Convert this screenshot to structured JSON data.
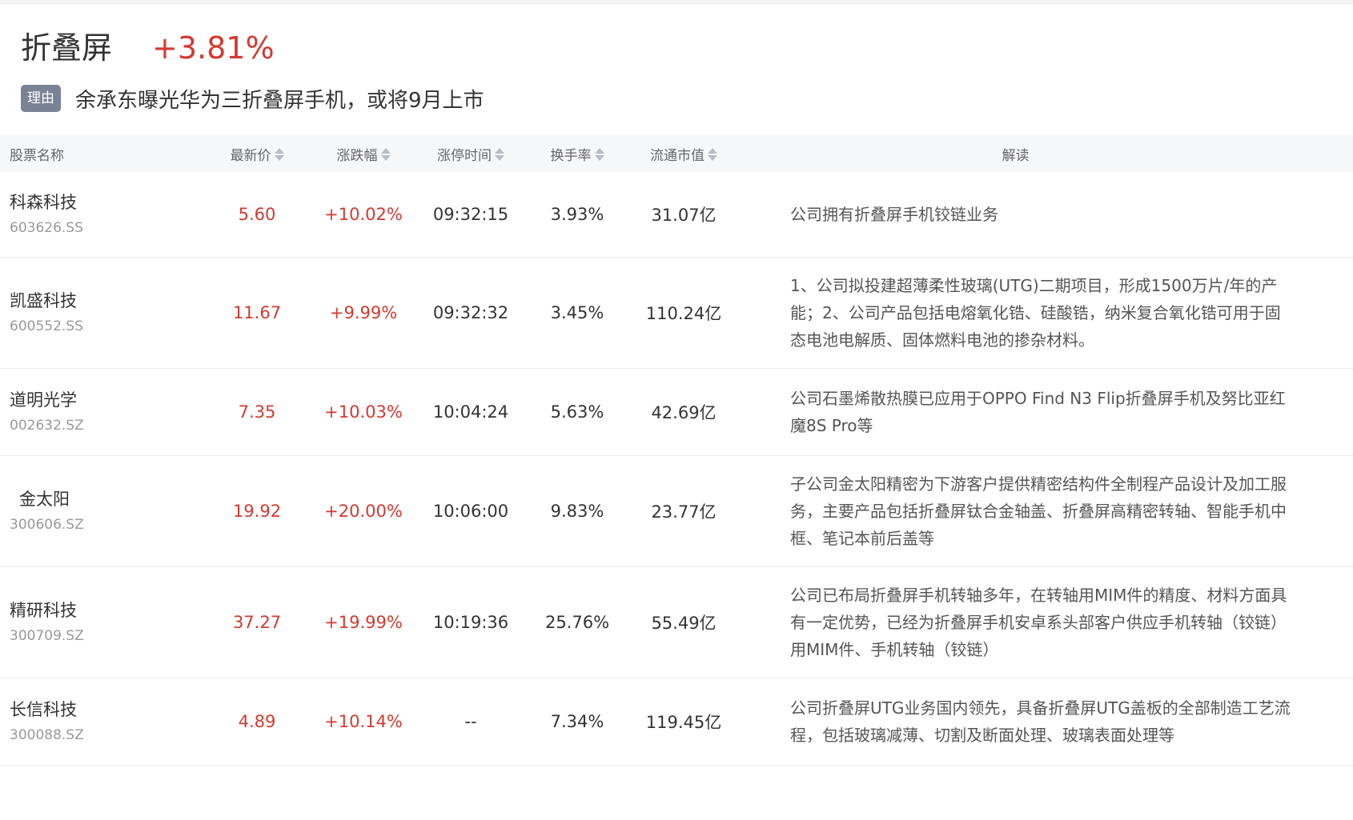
{
  "topic": {
    "title": "折叠屏",
    "change": "+3.81%",
    "reason_label": "理由",
    "reason_text": "余承东曝光华为三折叠屏手机，或将9月上市"
  },
  "table": {
    "columns": [
      "股票名称",
      "最新价",
      "涨跌幅",
      "涨停时间",
      "换手率",
      "流通市值",
      "解读"
    ],
    "sortable_columns": [
      "最新价",
      "涨跌幅",
      "涨停时间",
      "换手率",
      "流通市值"
    ],
    "rows": [
      {
        "name": "科森科技",
        "code": "603626.SS",
        "price": "5.60",
        "change": "+10.02%",
        "limit_time": "09:32:15",
        "turnover": "3.93%",
        "float_cap": "31.07亿",
        "desc": "公司拥有折叠屏手机铰链业务"
      },
      {
        "name": "凯盛科技",
        "code": "600552.SS",
        "price": "11.67",
        "change": "+9.99%",
        "limit_time": "09:32:32",
        "turnover": "3.45%",
        "float_cap": "110.24亿",
        "desc": "1、公司拟投建超薄柔性玻璃(UTG)二期项目，形成1500万片/年的产能；2、公司产品包括电熔氧化锆、硅酸锆，纳米复合氧化锆可用于固态电池电解质、固体燃料电池的掺杂材料。"
      },
      {
        "name": "道明光学",
        "code": "002632.SZ",
        "price": "7.35",
        "change": "+10.03%",
        "limit_time": "10:04:24",
        "turnover": "5.63%",
        "float_cap": "42.69亿",
        "desc": "公司石墨烯散热膜已应用于OPPO Find N3 Flip折叠屏手机及努比亚红魔8S Pro等"
      },
      {
        "name": "金太阳",
        "code": "300606.SZ",
        "price": "19.92",
        "change": "+20.00%",
        "limit_time": "10:06:00",
        "turnover": "9.83%",
        "float_cap": "23.77亿",
        "desc": "子公司金太阳精密为下游客户提供精密结构件全制程产品设计及加工服务，主要产品包括折叠屏钛合金轴盖、折叠屏高精密转轴、智能手机中框、笔记本前后盖等"
      },
      {
        "name": "精研科技",
        "code": "300709.SZ",
        "price": "37.27",
        "change": "+19.99%",
        "limit_time": "10:19:36",
        "turnover": "25.76%",
        "float_cap": "55.49亿",
        "desc": "公司已布局折叠屏手机转轴多年，在转轴用MIM件的精度、材料方面具有一定优势，已经为折叠屏手机安卓系头部客户供应手机转轴（铰链）用MIM件、手机转轴（铰链）"
      },
      {
        "name": "长信科技",
        "code": "300088.SZ",
        "price": "4.89",
        "change": "+10.14%",
        "limit_time": "--",
        "turnover": "7.34%",
        "float_cap": "119.45亿",
        "desc": "公司折叠屏UTG业务国内领先，具备折叠屏UTG盖板的全部制造工艺流程，包括玻璃减薄、切割及断面处理、玻璃表面处理等"
      }
    ]
  },
  "colors": {
    "up_red": "#d23a30",
    "badge_bg": "#7a8395",
    "header_bg": "#f6f7f9"
  }
}
